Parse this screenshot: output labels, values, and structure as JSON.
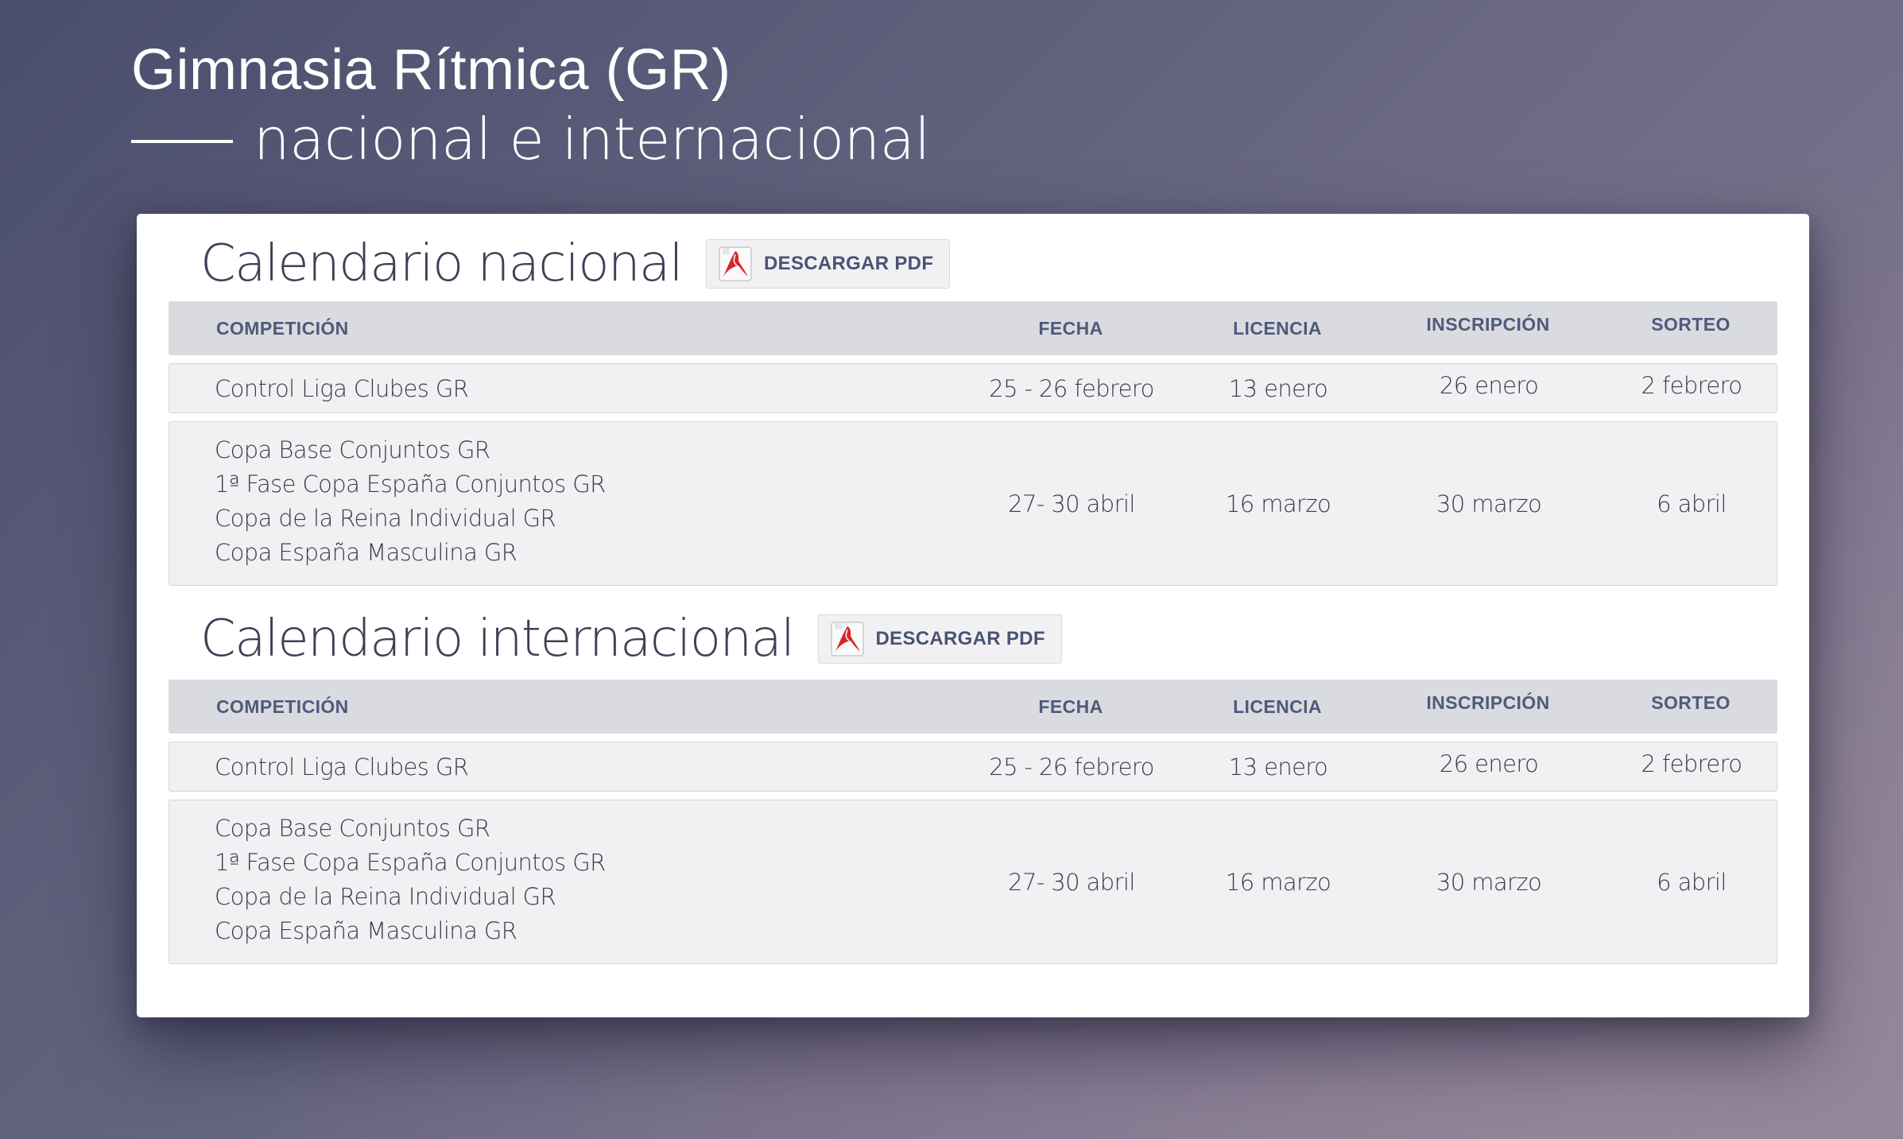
{
  "hero": {
    "title": "Gimnasia Rítmica (GR)",
    "subtitle": "nacional e internacional"
  },
  "colors": {
    "accent_text": "#4f5a7a",
    "header_bg": "#d9dbe0",
    "row_bg": "#f0f1f3"
  },
  "sections": [
    {
      "title": "Calendario nacional",
      "pdf_button": "DESCARGAR PDF",
      "pdf_icon": "acrobat-pdf-icon",
      "columns": [
        "COMPETICIÓN",
        "FECHA",
        "LICENCIA",
        "INSCRIPCIÓN",
        "SORTEO"
      ],
      "rows": [
        {
          "competitions": [
            "Control Liga Clubes GR"
          ],
          "fecha": "25 - 26 febrero",
          "licencia": "13 enero",
          "inscripcion": "26 enero",
          "sorteo": "2 febrero"
        },
        {
          "competitions": [
            "Copa Base Conjuntos GR",
            "1ª Fase Copa España Conjuntos GR",
            "Copa de la Reina Individual GR",
            "Copa España Masculina GR"
          ],
          "fecha": "27- 30 abril",
          "licencia": "16 marzo",
          "inscripcion": "30 marzo",
          "sorteo": "6 abril"
        }
      ]
    },
    {
      "title": "Calendario internacional",
      "pdf_button": "DESCARGAR PDF",
      "pdf_icon": "acrobat-pdf-icon",
      "columns": [
        "COMPETICIÓN",
        "FECHA",
        "LICENCIA",
        "INSCRIPCIÓN",
        "SORTEO"
      ],
      "rows": [
        {
          "competitions": [
            "Control Liga Clubes GR"
          ],
          "fecha": "25 - 26 febrero",
          "licencia": "13 enero",
          "inscripcion": "26 enero",
          "sorteo": "2 febrero"
        },
        {
          "competitions": [
            "Copa Base Conjuntos GR",
            "1ª Fase Copa España Conjuntos GR",
            "Copa de la Reina Individual GR",
            "Copa España Masculina GR"
          ],
          "fecha": "27- 30 abril",
          "licencia": "16 marzo",
          "inscripcion": "30 marzo",
          "sorteo": "6 abril"
        }
      ]
    }
  ]
}
